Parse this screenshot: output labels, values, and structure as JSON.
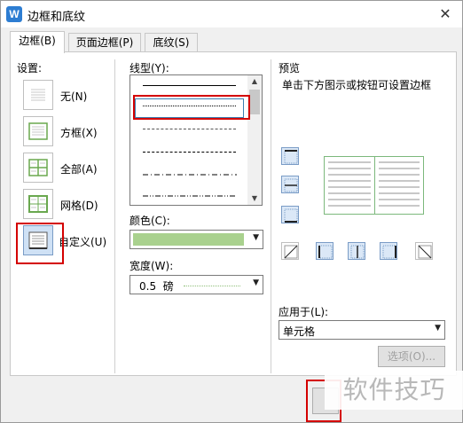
{
  "window": {
    "title": "边框和底纹"
  },
  "tabs": [
    {
      "label": "边框(B)"
    },
    {
      "label": "页面边框(P)"
    },
    {
      "label": "底纹(S)"
    }
  ],
  "settings": {
    "label": "设置:",
    "items": [
      {
        "label": "无(N)"
      },
      {
        "label": "方框(X)"
      },
      {
        "label": "全部(A)"
      },
      {
        "label": "网格(D)"
      },
      {
        "label": "自定义(U)"
      }
    ],
    "selected": "自定义(U)"
  },
  "style": {
    "line_type_label": "线型(Y):",
    "color_label": "颜色(C):",
    "color_value": "#a9d18e",
    "width_label": "宽度(W):",
    "width_value": "0.5  磅"
  },
  "preview": {
    "label": "预览",
    "hint": "单击下方图示或按钮可设置边框",
    "apply_to_label": "应用于(L):",
    "apply_to_value": "单元格"
  },
  "buttons": {
    "options_label": "选项(O)..."
  },
  "watermark": {
    "text": "软件技巧"
  },
  "colors": {
    "highlight": "#d40000",
    "accent": "#2d7dd2"
  }
}
